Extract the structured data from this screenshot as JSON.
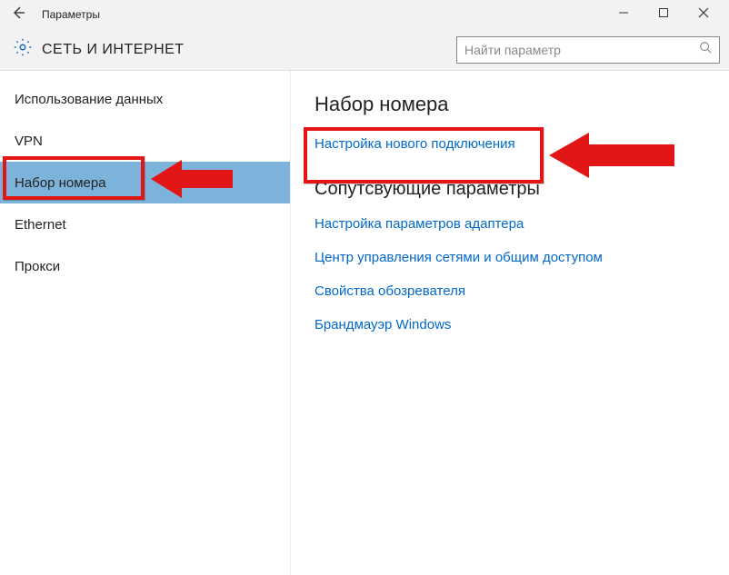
{
  "titlebar": {
    "window_title": "Параметры"
  },
  "header": {
    "section_title": "СЕТЬ И ИНТЕРНЕТ"
  },
  "search": {
    "placeholder": "Найти параметр"
  },
  "sidebar": {
    "items": [
      {
        "label": "Использование данных"
      },
      {
        "label": "VPN"
      },
      {
        "label": "Набор номера",
        "active": true
      },
      {
        "label": "Ethernet"
      },
      {
        "label": "Прокси"
      }
    ]
  },
  "main": {
    "heading": "Набор номера",
    "primary_link": "Настройка нового подключения",
    "related_heading": "Сопутсвующие параметры",
    "related_links": [
      "Настройка параметров адаптера",
      "Центр управления сетями и общим доступом",
      "Свойства обозревателя",
      "Брандмауэр Windows"
    ]
  }
}
